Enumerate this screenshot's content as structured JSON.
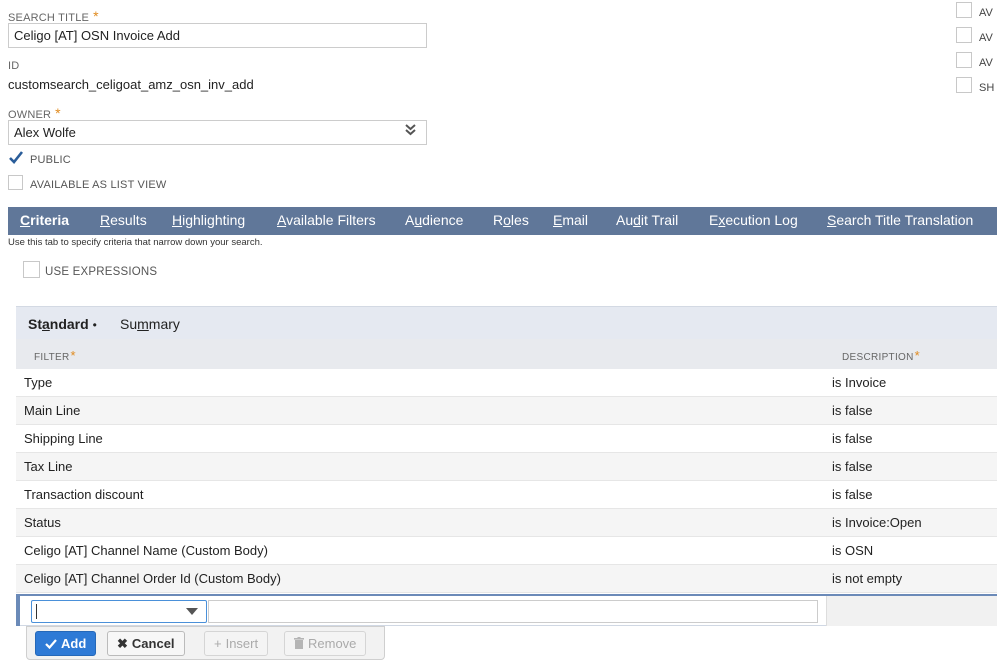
{
  "form": {
    "search_title_label": "SEARCH TITLE",
    "search_title_value": "Celigo [AT] OSN Invoice Add",
    "id_label": "ID",
    "id_value": "customsearch_celigoat_amz_osn_inv_add",
    "owner_label": "OWNER",
    "owner_value": "Alex Wolfe",
    "required_marker": "*",
    "public_label": "PUBLIC",
    "public_checked": true,
    "list_view_label": "AVAILABLE AS LIST VIEW",
    "list_view_checked": false
  },
  "right_options": [
    {
      "label": "AV",
      "checked": false
    },
    {
      "label": "AV",
      "checked": false
    },
    {
      "label": "AV",
      "checked": false
    },
    {
      "label": "SH",
      "checked": false
    }
  ],
  "tabs": [
    {
      "pre": "",
      "ul": "C",
      "post": "riteria",
      "active": true
    },
    {
      "pre": "",
      "ul": "R",
      "post": "esults",
      "active": false
    },
    {
      "pre": "",
      "ul": "H",
      "post": "ighlighting",
      "active": false
    },
    {
      "pre": "",
      "ul": "A",
      "post": "vailable Filters",
      "active": false
    },
    {
      "pre": "A",
      "ul": "u",
      "post": "dience",
      "active": false
    },
    {
      "pre": "R",
      "ul": "o",
      "post": "les",
      "active": false
    },
    {
      "pre": "",
      "ul": "E",
      "post": "mail",
      "active": false
    },
    {
      "pre": "Au",
      "ul": "d",
      "post": "it Trail",
      "active": false
    },
    {
      "pre": "E",
      "ul": "x",
      "post": "ecution Log",
      "active": false
    },
    {
      "pre": "",
      "ul": "S",
      "post": "earch Title Translation",
      "active": false
    }
  ],
  "criteria": {
    "hint": "Use this tab to specify criteria that narrow down your search.",
    "use_expressions_label": "USE EXPRESSIONS",
    "use_expressions_checked": false
  },
  "subtabs": {
    "standard_pre": "St",
    "standard_ul": "a",
    "standard_post": "ndard",
    "standard_dot": "•",
    "summary_pre": "Su",
    "summary_ul": "m",
    "summary_post": "mary"
  },
  "table": {
    "col_filter": "FILTER",
    "col_description": "DESCRIPTION",
    "rows": [
      {
        "filter": "Type",
        "description": "is Invoice"
      },
      {
        "filter": "Main Line",
        "description": "is false"
      },
      {
        "filter": "Shipping Line",
        "description": "is false"
      },
      {
        "filter": "Tax Line",
        "description": "is false"
      },
      {
        "filter": "Transaction discount",
        "description": "is false"
      },
      {
        "filter": "Status",
        "description": "is Invoice:Open"
      },
      {
        "filter": "Celigo [AT] Channel Name (Custom Body)",
        "description": "is OSN"
      },
      {
        "filter": "Celigo [AT] Channel Order Id (Custom Body)",
        "description": "is not empty"
      }
    ]
  },
  "buttons": {
    "add": "Add",
    "cancel": "Cancel",
    "insert": "Insert",
    "remove": "Remove"
  },
  "colors": {
    "tab_bar": "#607799",
    "primary_button": "#2e7ad6",
    "required_marker": "#e08a1e"
  }
}
